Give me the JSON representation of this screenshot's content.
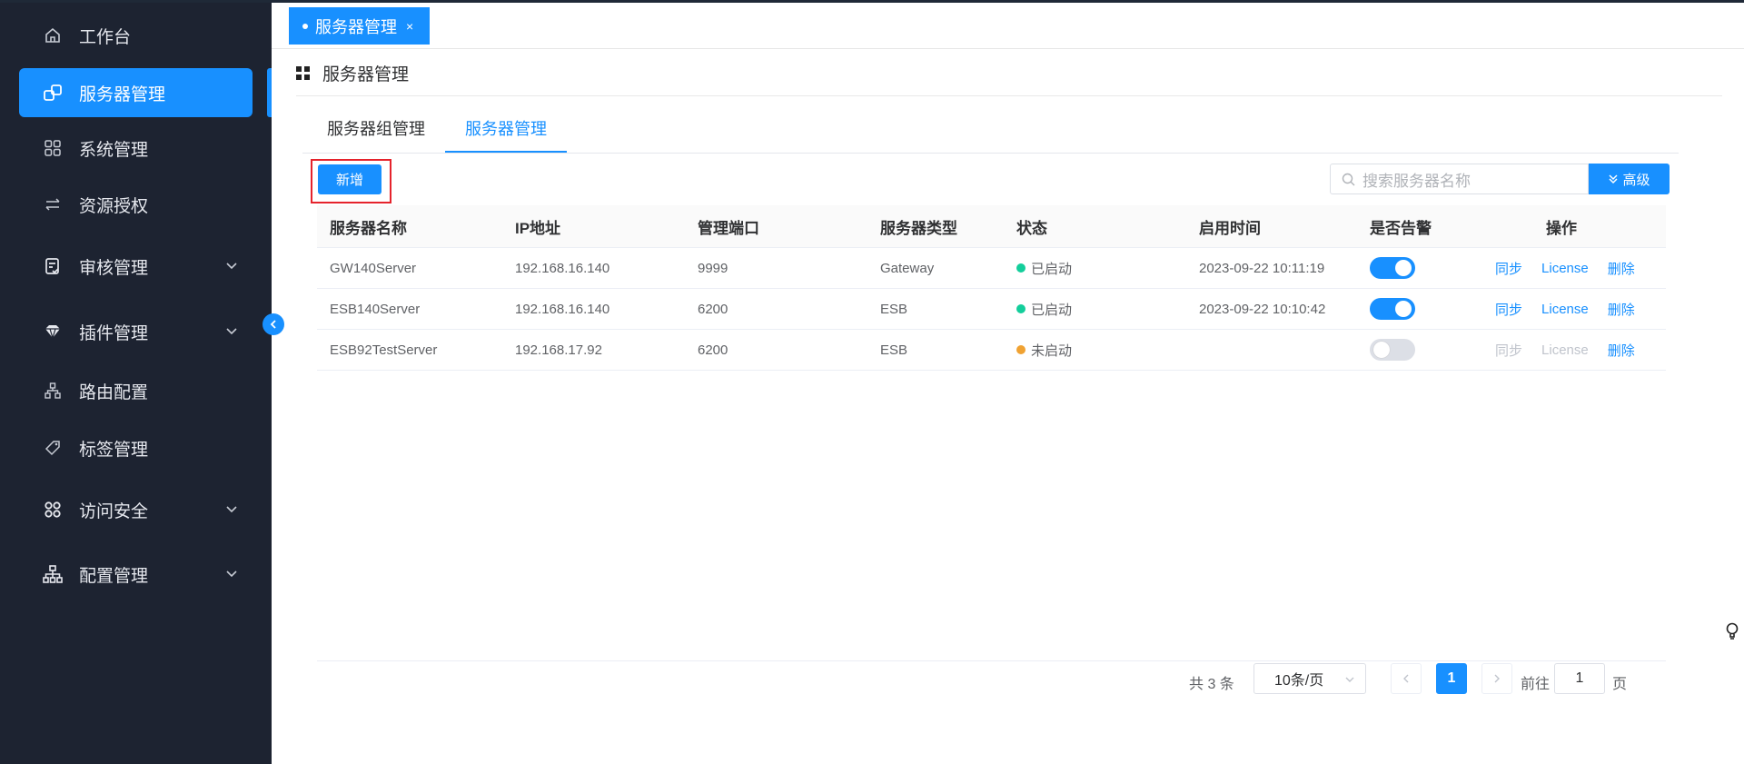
{
  "sidebar": {
    "items": [
      {
        "label": "工作台",
        "icon": "home-icon"
      },
      {
        "label": "服务器管理",
        "icon": "server-icon",
        "active": true
      },
      {
        "label": "系统管理",
        "icon": "apps-grid-icon"
      },
      {
        "label": "资源授权",
        "icon": "transfer-icon"
      },
      {
        "label": "审核管理",
        "icon": "audit-doc-icon",
        "expandable": true
      },
      {
        "label": "插件管理",
        "icon": "diamond-icon",
        "expandable": true
      },
      {
        "label": "路由配置",
        "icon": "route-tree-icon"
      },
      {
        "label": "标签管理",
        "icon": "tag-icon"
      },
      {
        "label": "访问安全",
        "icon": "security-grid-icon",
        "expandable": true
      },
      {
        "label": "配置管理",
        "icon": "config-tree-icon",
        "expandable": true
      }
    ]
  },
  "top_tab": {
    "label": "服务器管理",
    "close": "×"
  },
  "page": {
    "title": "服务器管理"
  },
  "inner_tabs": [
    {
      "label": "服务器组管理"
    },
    {
      "label": "服务器管理",
      "active": true
    }
  ],
  "toolbar": {
    "add_label": "新增",
    "search_placeholder": "搜索服务器名称",
    "advanced_label": "高级"
  },
  "table": {
    "headers": [
      "服务器名称",
      "IP地址",
      "管理端口",
      "服务器类型",
      "状态",
      "启用时间",
      "是否告警",
      "操作"
    ],
    "rows": [
      {
        "name": "GW140Server",
        "ip": "192.168.16.140",
        "port": "9999",
        "type": "Gateway",
        "status": "已启动",
        "status_color": "#13ce9b",
        "time": "2023-09-22 10:11:19",
        "alarm": true,
        "ops": [
          "同步",
          "License",
          "删除"
        ],
        "ops_enabled": true
      },
      {
        "name": "ESB140Server",
        "ip": "192.168.16.140",
        "port": "6200",
        "type": "ESB",
        "status": "已启动",
        "status_color": "#13ce9b",
        "time": "2023-09-22 10:10:42",
        "alarm": true,
        "ops": [
          "同步",
          "License",
          "删除"
        ],
        "ops_enabled": true
      },
      {
        "name": "ESB92TestServer",
        "ip": "192.168.17.92",
        "port": "6200",
        "type": "ESB",
        "status": "未启动",
        "status_color": "#f0a232",
        "time": "",
        "alarm": false,
        "ops": [
          "同步",
          "License",
          "删除"
        ],
        "ops_enabled": false
      }
    ]
  },
  "pagination": {
    "total_text": "共 3 条",
    "page_size": "10条/页",
    "current_page": "1",
    "goto_label": "前往",
    "goto_value": "1",
    "page_suffix": "页"
  },
  "colors": {
    "accent": "#1890ff",
    "sidebar_bg": "#1d2331",
    "highlight": "#e5232c"
  }
}
